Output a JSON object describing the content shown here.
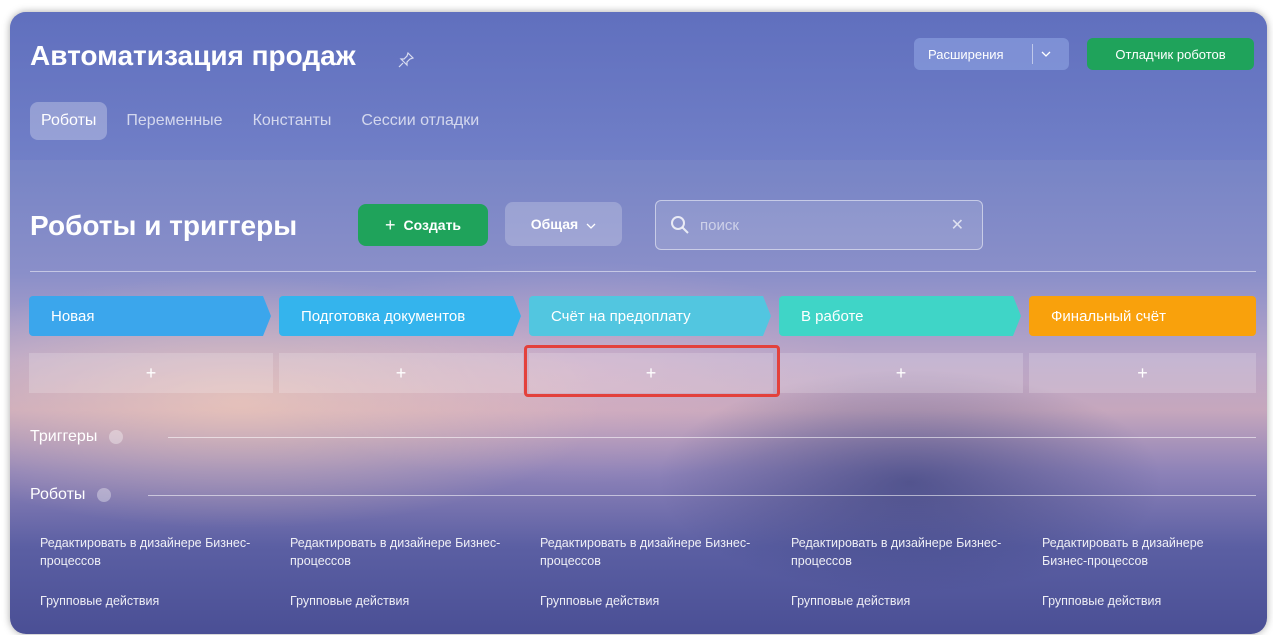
{
  "app_title": "Автоматизация продаж",
  "header": {
    "extensions_label": "Расширения",
    "debugger_label": "Отладчик роботов"
  },
  "tabs": [
    {
      "label": "Роботы",
      "active": true
    },
    {
      "label": "Переменные",
      "active": false
    },
    {
      "label": "Константы",
      "active": false
    },
    {
      "label": "Сессии отладки",
      "active": false
    }
  ],
  "toolbar": {
    "title": "Роботы и триггеры",
    "create_label": "Создать",
    "category_label": "Общая",
    "search_placeholder": "поиск"
  },
  "stages": [
    {
      "label": "Новая",
      "color": "#3ba6ec"
    },
    {
      "label": "Подготовка документов",
      "color": "#34b4ed"
    },
    {
      "label": "Счёт на предоплату",
      "color": "#52c6e0"
    },
    {
      "label": "В работе",
      "color": "#3fd5c7"
    },
    {
      "label": "Финальный счёт",
      "color": "#f9a10c"
    }
  ],
  "add_cells": [
    "+",
    "+",
    "+",
    "+",
    "+"
  ],
  "sections": {
    "triggers_label": "Триггеры",
    "robots_label": "Роботы"
  },
  "column_links": [
    {
      "edit": "Редактировать в дизайнере Бизнес-процессов",
      "group": "Групповые действия"
    },
    {
      "edit": "Редактировать в дизайнере Бизнес-процессов",
      "group": "Групповые действия"
    },
    {
      "edit": "Редактировать в дизайнере Бизнес-процессов",
      "group": "Групповые действия"
    },
    {
      "edit": "Редактировать в дизайнере Бизнес-процессов",
      "group": "Групповые действия"
    },
    {
      "edit": "Редактировать в дизайнере Бизнес-процессов",
      "group": "Групповые действия"
    }
  ],
  "colors": {
    "accent_green": "#1fa35b",
    "highlight_red": "#e3413c"
  }
}
